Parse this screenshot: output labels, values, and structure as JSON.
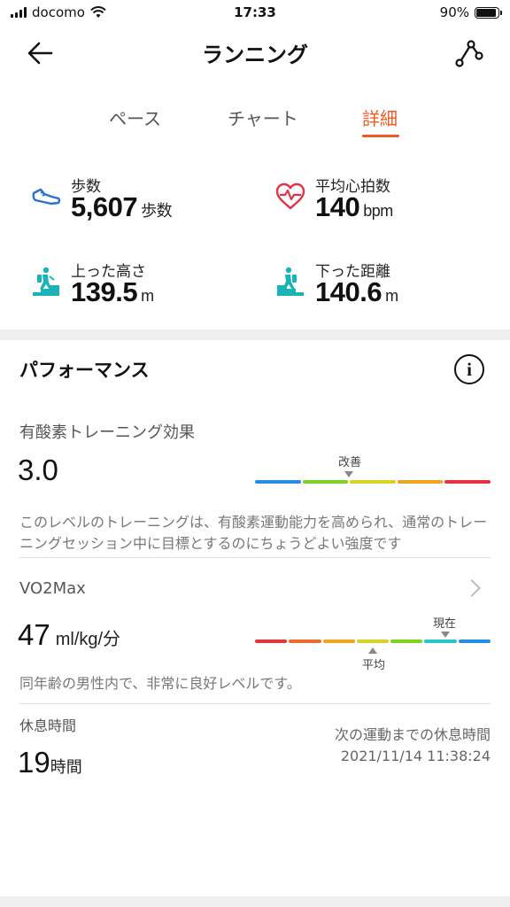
{
  "status_bar": {
    "carrier": "docomo",
    "time": "17:33",
    "battery": "90%",
    "battery_level": 0.9
  },
  "header": {
    "title": "ランニング",
    "back_icon": "arrow-left-icon",
    "route_icon": "route-share-icon"
  },
  "tabs": [
    {
      "label": "ペース",
      "active": false
    },
    {
      "label": "チャート",
      "active": false
    },
    {
      "label": "詳細",
      "active": true
    }
  ],
  "colors": {
    "accent": "#ee5a24",
    "icon_blue": "#2a6fd6",
    "icon_red": "#e0334a",
    "icon_teal": "#19b3b8"
  },
  "metrics": [
    {
      "label": "歩数",
      "value": "5,607",
      "unit": "歩数",
      "icon": "shoe-icon"
    },
    {
      "label": "平均心拍数",
      "value": "140",
      "unit": "bpm",
      "icon": "heart-rate-icon"
    },
    {
      "label": "上った高さ",
      "value": "139.5",
      "unit": "m",
      "icon": "hiker-up-icon"
    },
    {
      "label": "下った距離",
      "value": "140.6",
      "unit": "m",
      "icon": "hiker-down-icon"
    }
  ],
  "performance": {
    "title": "パフォーマンス",
    "info_icon": "info-icon",
    "aerobic": {
      "label": "有酸素トレーニング効果",
      "value": "3.0",
      "marker_label": "改善",
      "bar_colors": [
        "#2b8de0",
        "#7ed321",
        "#d8d325",
        "#f0a424",
        "#e6323c"
      ],
      "marker_position": 0.4,
      "description": "このレベルのトレーニングは、有酸素運動能力を高められ、通常のトレーニングセッション中に目標とするのにちょうどよい強度です"
    },
    "vo2max": {
      "label": "VO2Max",
      "value": "47",
      "unit": "ml/kg/分",
      "current_label": "現在",
      "average_label": "平均",
      "bar_colors": [
        "#e6323c",
        "#ee6a2a",
        "#f0a424",
        "#d8d325",
        "#7ed321",
        "#2ac4c8",
        "#2b8de0"
      ],
      "current_position": 0.81,
      "average_position": 0.5,
      "description": "同年齢の男性内で、非常に良好レベルです。"
    },
    "rest": {
      "label": "休息時間",
      "value": "19",
      "unit": "時間",
      "next_label": "次の運動までの休息時間",
      "next_datetime": "2021/11/14 11:38:24"
    }
  }
}
